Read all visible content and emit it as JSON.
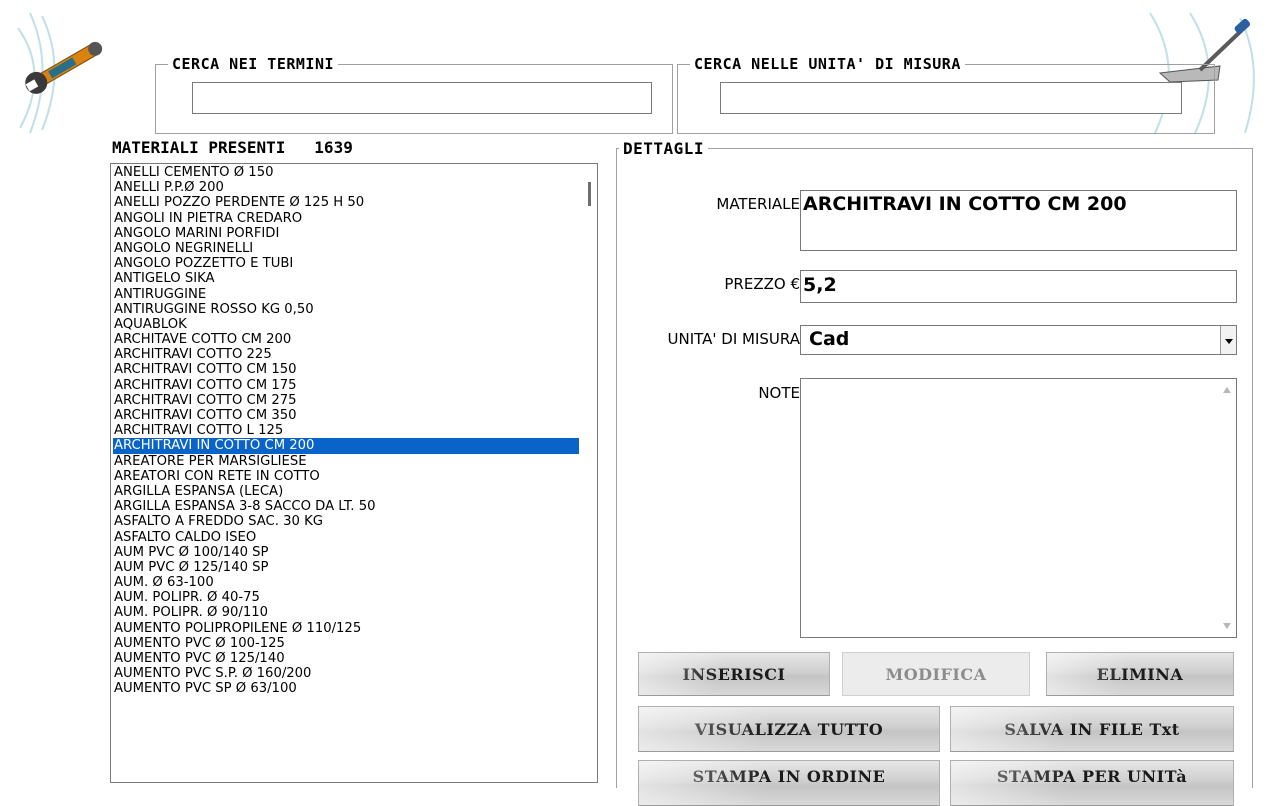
{
  "search_terms": {
    "label": "CERCA NEI TERMINI",
    "value": ""
  },
  "search_units": {
    "label": "CERCA NELLE UNITA' DI MISURA",
    "value": ""
  },
  "materials": {
    "title": "MATERIALI PRESENTI",
    "count": "1639",
    "selected_index": 19,
    "items": [
      "ANELLI CEMENTO Ø 150",
      "ANELLI P.P.Ø 200",
      "ANELLI POZZO PERDENTE Ø 125 H 50",
      "ANGOLI IN PIETRA CREDARO",
      "ANGOLO MARINI PORFIDI",
      "ANGOLO NEGRINELLI",
      "ANGOLO POZZETTO E TUBI",
      "ANTIGELO SIKA",
      "ANTIRUGGINE",
      "ANTIRUGGINE ROSSO KG 0,50",
      "AQUABLOK",
      "ARCHITAVE COTTO CM 200",
      "ARCHITRAVI COTTO 225",
      "ARCHITRAVI COTTO CM 150",
      "ARCHITRAVI COTTO CM 175",
      "ARCHITRAVI COTTO CM 275",
      "ARCHITRAVI COTTO CM 350",
      "ARCHITRAVI COTTO L 125",
      "ARCHITRAVI IN COTTO CM 200",
      "AREATORE PER MARSIGLIESE",
      "AREATORI CON RETE IN COTTO",
      "ARGILLA ESPANSA (LECA)",
      "ARGILLA ESPANSA 3-8 SACCO DA LT. 50",
      "ASFALTO A FREDDO SAC. 30 KG",
      "ASFALTO CALDO ISEO",
      "AUM PVC Ø 100/140 SP",
      "AUM PVC Ø 125/140 SP",
      "AUM. Ø 63-100",
      "AUM. POLIPR. Ø 40-75",
      "AUM. POLIPR. Ø 90/110",
      "AUMENTO POLIPROPILENE Ø 110/125",
      "AUMENTO PVC Ø 100-125",
      "AUMENTO PVC Ø 125/140",
      "AUMENTO PVC S.P. Ø 160/200",
      "AUMENTO PVC SP Ø 63/100"
    ]
  },
  "details": {
    "legend": "DETTAGLI",
    "material_label": "MATERIALE",
    "material_value": "ARCHITRAVI IN COTTO CM 200",
    "price_label": "PREZZO €",
    "price_value": "5,2",
    "unit_label": "UNITA' DI MISURA",
    "unit_value": "Cad",
    "notes_label": "NOTE",
    "notes_value": ""
  },
  "buttons": {
    "insert": "INSERISCI",
    "modify": "MODIFICA",
    "delete": "ELIMINA",
    "view_all": "VISUALIZZA TUTTO",
    "save_txt": "SALVA IN FILE Txt",
    "print_order": "STAMPA IN ORDINE",
    "print_unit": "STAMPA PER UNITà"
  },
  "icons": {
    "left": "wrench-icon",
    "right": "trowel-icon"
  }
}
